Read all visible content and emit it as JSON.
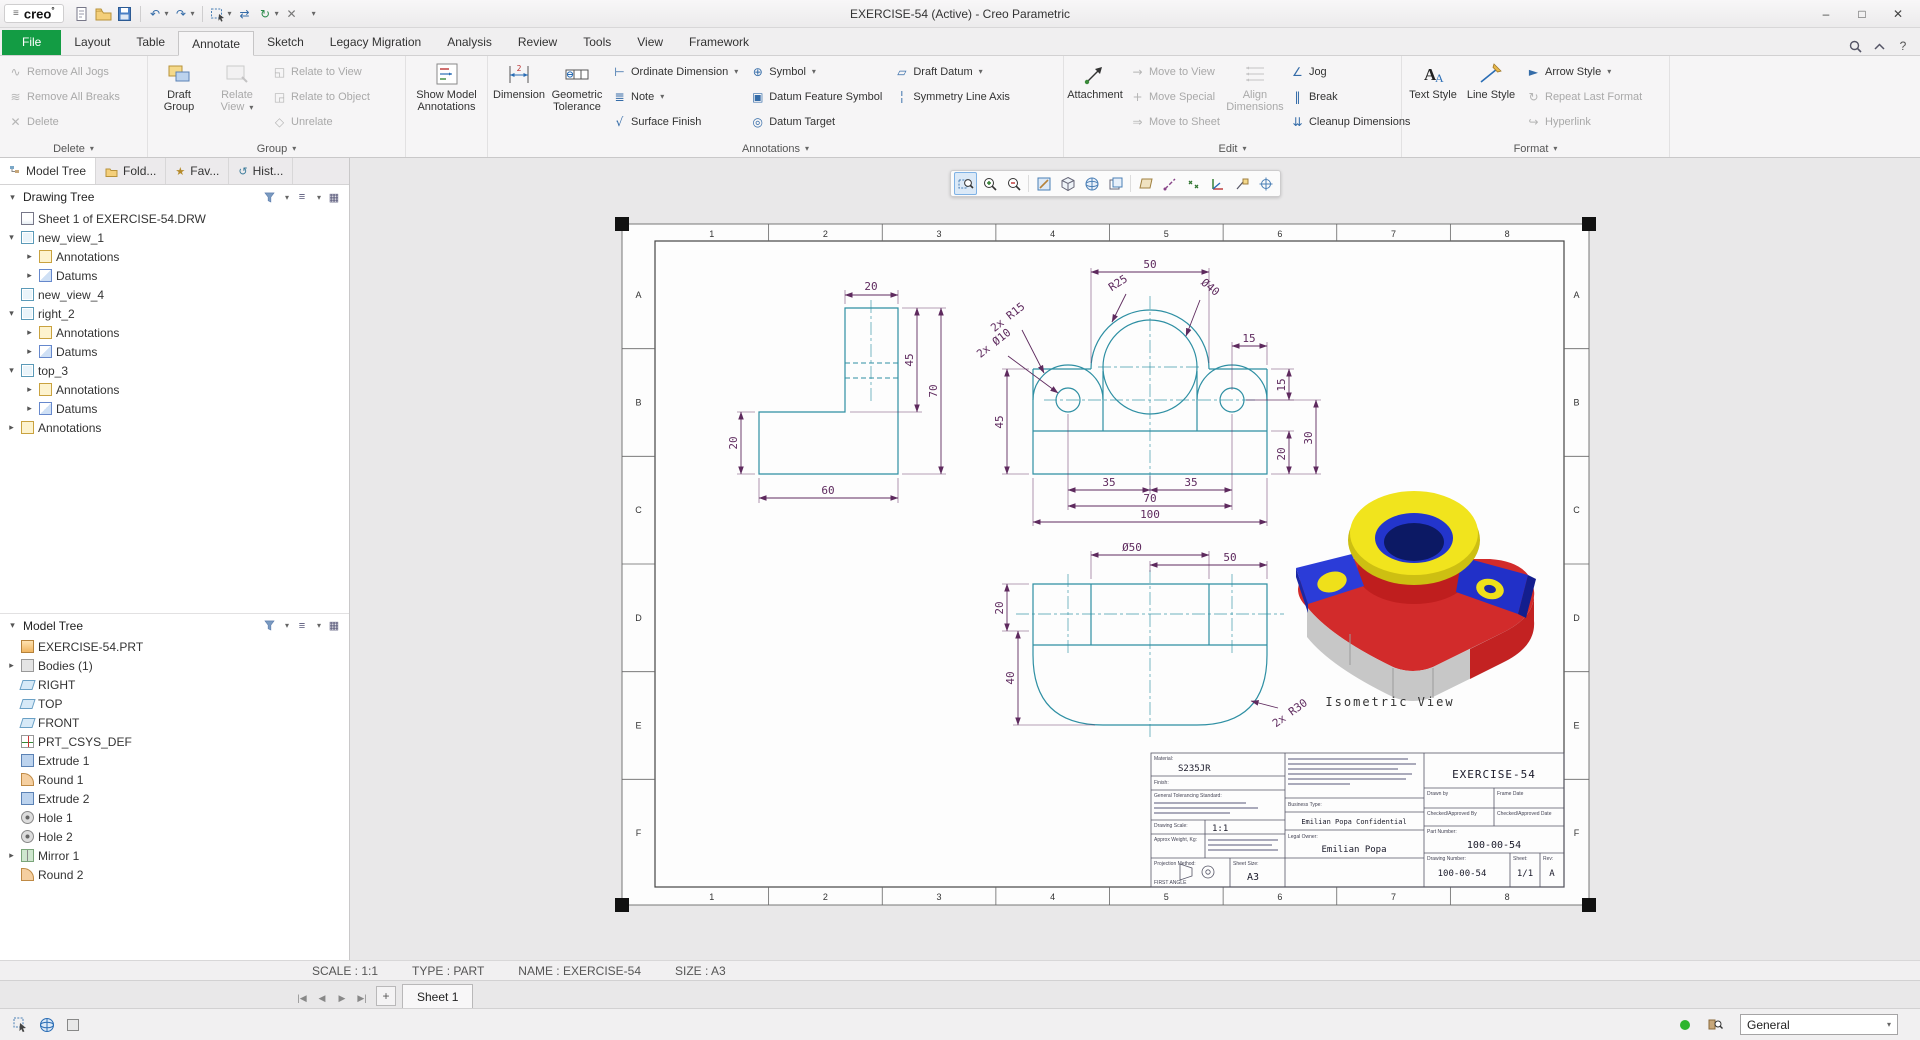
{
  "window": {
    "logo_text": "creo",
    "logo_sup": "°",
    "title": "EXERCISE-54 (Active) - Creo Parametric",
    "controls": {
      "min": "–",
      "max": "□",
      "close": "✕"
    }
  },
  "quick_access": {
    "undo_glyph": "↶",
    "redo_glyph": "↷",
    "swap_glyph": "⇄",
    "regen_glyph": "↻",
    "close_glyph": "✕",
    "more_glyph": "▾"
  },
  "ribbon_tabs": {
    "items": [
      "File",
      "Layout",
      "Table",
      "Annotate",
      "Sketch",
      "Legacy Migration",
      "Analysis",
      "Review",
      "Tools",
      "View",
      "Framework"
    ],
    "active": "Annotate"
  },
  "ribbon": {
    "icon_glyphs": {
      "dropdown": "▾",
      "jogs": "∿",
      "breaks": "≋",
      "delete": "✕",
      "relate_to_view": "◱",
      "relate_to_object": "◲",
      "unrelate": "◇",
      "ordinate": "⊢",
      "note": "≣",
      "surface_finish": "√",
      "symbol": "⊕",
      "datum_feature": "▣",
      "datum_target": "◎",
      "draft_datum": "▱",
      "symmetry": "╎",
      "move_view": "→",
      "move_special": "+",
      "move_sheet": "⇒",
      "jog": "∠",
      "break": "‖",
      "cleanup": "⇊",
      "arrow_style": "►",
      "repeat": "↻",
      "hyperlink": "↪"
    },
    "delete_group": {
      "label": "Delete",
      "remove_all_jogs": "Remove All Jogs",
      "remove_all_breaks": "Remove All Breaks",
      "delete": "Delete"
    },
    "group_group": {
      "label": "Group",
      "draft_group": "Draft Group",
      "relate_view": "Relate View",
      "relate_to_view": "Relate to View",
      "relate_to_object": "Relate to Object",
      "unrelate": "Unrelate"
    },
    "show_group": {
      "show_model_annotations": "Show Model Annotations"
    },
    "annotations_group": {
      "label": "Annotations",
      "dimension": "Dimension",
      "geometric_tolerance": "Geometric Tolerance",
      "ordinate_dimension": "Ordinate Dimension",
      "note": "Note",
      "surface_finish": "Surface Finish",
      "symbol": "Symbol",
      "datum_feature_symbol": "Datum Feature Symbol",
      "datum_target": "Datum Target",
      "draft_datum": "Draft Datum",
      "symmetry_line_axis": "Symmetry Line Axis"
    },
    "edit_group": {
      "label": "Edit",
      "attachment": "Attachment",
      "move_to_view": "Move to View",
      "move_special": "Move Special",
      "move_to_sheet": "Move to Sheet",
      "align_dimensions": "Align Dimensions",
      "jog": "Jog",
      "break": "Break",
      "cleanup_dimensions": "Cleanup Dimensions"
    },
    "format_group": {
      "label": "Format",
      "text_style": "Text Style",
      "line_style": "Line Style",
      "arrow_style": "Arrow Style",
      "repeat_last_format": "Repeat Last Format",
      "hyperlink": "Hyperlink"
    }
  },
  "sidebar": {
    "tabs": [
      {
        "label": "Model Tree"
      },
      {
        "label": "Fold..."
      },
      {
        "label": "Fav..."
      },
      {
        "label": "Hist..."
      }
    ],
    "tab_glyphs": {
      "fav": "★",
      "hist": "↺"
    },
    "drawing_tree": {
      "title": "Drawing Tree",
      "items": [
        {
          "label": "Sheet 1 of EXERCISE-54.DRW"
        },
        {
          "label": "new_view_1"
        },
        {
          "label": "Annotations"
        },
        {
          "label": "Datums"
        },
        {
          "label": "new_view_4"
        },
        {
          "label": "right_2"
        },
        {
          "label": "Annotations"
        },
        {
          "label": "Datums"
        },
        {
          "label": "top_3"
        },
        {
          "label": "Annotations"
        },
        {
          "label": "Datums"
        },
        {
          "label": "Annotations"
        }
      ]
    },
    "model_tree": {
      "title": "Model Tree",
      "items": [
        {
          "label": "EXERCISE-54.PRT"
        },
        {
          "label": "Bodies (1)"
        },
        {
          "label": "RIGHT"
        },
        {
          "label": "TOP"
        },
        {
          "label": "FRONT"
        },
        {
          "label": "PRT_CSYS_DEF"
        },
        {
          "label": "Extrude 1"
        },
        {
          "label": "Round 1"
        },
        {
          "label": "Extrude 2"
        },
        {
          "label": "Hole 1"
        },
        {
          "label": "Hole 2"
        },
        {
          "label": "Mirror 1"
        },
        {
          "label": "Round 2"
        }
      ]
    }
  },
  "drawing": {
    "colors": {
      "geometry": "#2e8fa3",
      "dimension": "#5e2a5e",
      "sheet": "#fdfdfd"
    },
    "zones": {
      "cols": [
        "1",
        "2",
        "3",
        "4",
        "5",
        "6",
        "7",
        "8"
      ],
      "rows": [
        "A",
        "B",
        "C",
        "D",
        "E",
        "F"
      ]
    },
    "dims": {
      "side_top": "20",
      "side_right": "70",
      "side_mid": "45",
      "side_left": "20",
      "side_bottom": "60",
      "front_width": "50",
      "front_r25": "R25",
      "front_d40": "Ø40",
      "front_r15": "2x R15",
      "front_d10": "2x Ø10",
      "front_15h": "15",
      "front_15v": "15",
      "front_45": "45",
      "front_30": "30",
      "front_20": "20",
      "front_35a": "35",
      "front_35b": "35",
      "front_70": "70",
      "front_100": "100",
      "bottom_d50": "Ø50",
      "bottom_50": "50",
      "bottom_20": "20",
      "bottom_40": "40",
      "bottom_r30": "2x R30"
    },
    "iso_label": "Isometric View",
    "titleblock": {
      "material_label": "Material:",
      "material": "S235JR",
      "finish_label": "Finish:",
      "tolerance_label": "General Tolerancing Standard:",
      "scale_label": "Drawing Scale:",
      "scale": "1:1",
      "weight_label": "Approx Weight, Kg:",
      "projection_label": "Projection Method:",
      "projection": "FIRST ANGLE",
      "sheet_size_label": "Sheet Size:",
      "sheet_size": "A3",
      "business_label": "Business Type:",
      "confidential": "Emilian Popa Confidential",
      "legal_owner_label": "Legal Owner:",
      "legal_owner": "Emilian Popa",
      "title": "EXERCISE-54",
      "drawn_by_label": "Drawn by",
      "frame_date_label": "Frame Date",
      "checked_by_label": "Checked/Approved By",
      "checked_date_label": "Checked/Approved Date",
      "part_number_label": "Part Number:",
      "part_number": "100-00-54",
      "drawing_number_label": "Drawing Number:",
      "drawing_number": "100-00-54",
      "sheet_label": "Sheet:",
      "sheet": "1/1",
      "revision_label": "Rev:",
      "revision": "A"
    }
  },
  "statusbar": {
    "scale": "SCALE : 1:1",
    "type": "TYPE : PART",
    "name": "NAME : EXERCISE-54",
    "size": "SIZE : A3"
  },
  "sheet_tabs": {
    "active": "Sheet 1",
    "add_glyph": "+",
    "nav": {
      "first": "|◀",
      "prev": "◀",
      "next": "▶",
      "last": "▶|"
    }
  },
  "bottom_bar": {
    "selector_value": "General"
  }
}
